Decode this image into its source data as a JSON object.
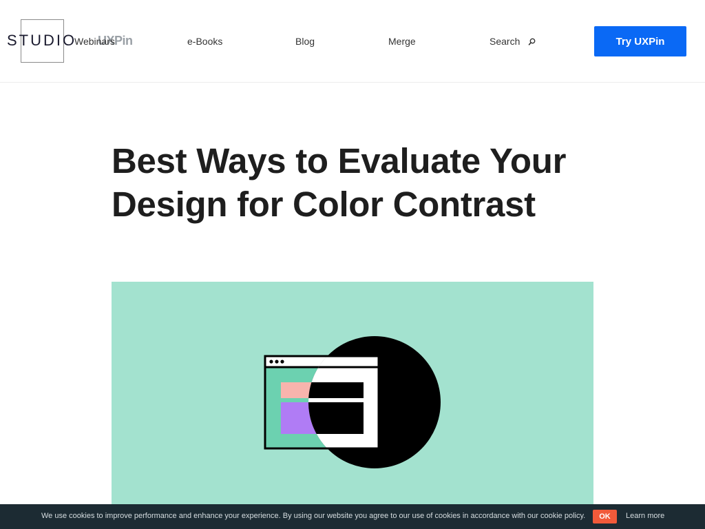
{
  "header": {
    "logo_text": "STUDIO",
    "logo_sub": "UXPin",
    "nav": {
      "webinars": "Webinars",
      "ebooks": "e-Books",
      "blog": "Blog",
      "merge": "Merge",
      "search": "Search"
    },
    "cta_label": "Try UXPin",
    "cta_color": "#0a69f5"
  },
  "article": {
    "title": "Best Ways to Evaluate Your Design for Color Contrast"
  },
  "hero": {
    "background_color": "#a3e2cf",
    "illustration": "browser-window-contrast-circle"
  },
  "cookie_bar": {
    "message": "We use cookies to improve performance and enhance your experience. By using our website you agree to our use of cookies in accordance with our cookie policy.",
    "ok_label": "OK",
    "learn_more_label": "Learn more",
    "ok_color": "#f15a3a"
  }
}
